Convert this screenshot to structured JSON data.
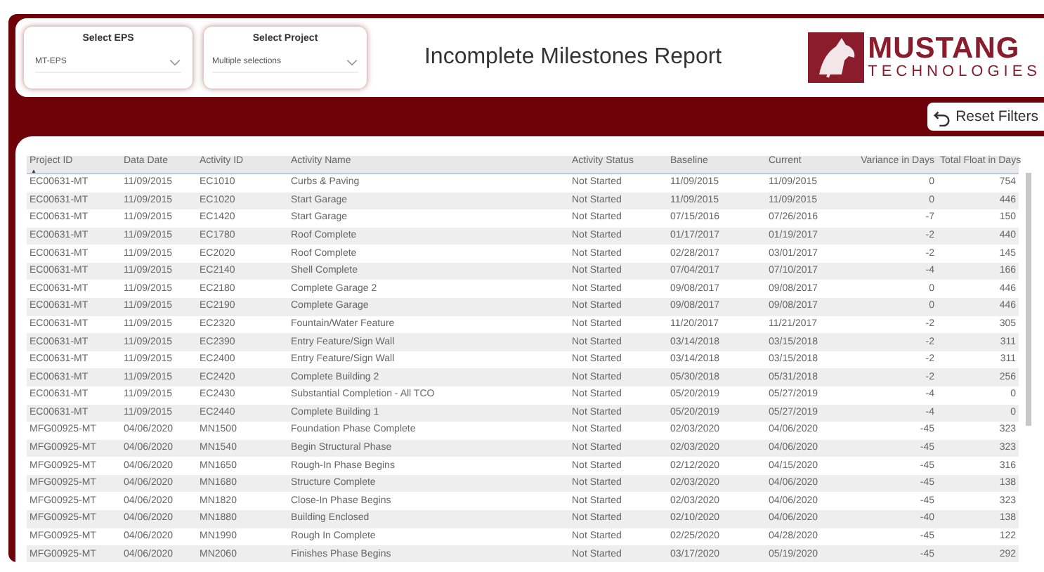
{
  "filters": [
    {
      "label": "Select EPS",
      "value": "MT-EPS"
    },
    {
      "label": "Select Project",
      "value": "Multiple selections"
    }
  ],
  "title": "Incomplete Milestones Report",
  "logo": {
    "name": "MUSTANG",
    "tagline": "TECHNOLOGIES"
  },
  "reset_button": "Reset Filters",
  "table": {
    "columns": [
      {
        "label": "Project ID",
        "kind": "text",
        "sorted": true
      },
      {
        "label": "Data Date",
        "kind": "text",
        "sorted": false
      },
      {
        "label": "Activity ID",
        "kind": "text",
        "sorted": false
      },
      {
        "label": "Activity Name",
        "kind": "text",
        "sorted": false
      },
      {
        "label": "Activity Status",
        "kind": "text",
        "sorted": false
      },
      {
        "label": "Baseline",
        "kind": "text",
        "sorted": false
      },
      {
        "label": "Current",
        "kind": "text",
        "sorted": false
      },
      {
        "label": "Variance in Days",
        "kind": "number",
        "sorted": false
      },
      {
        "label": "Total Float in Days",
        "kind": "number",
        "sorted": false
      }
    ],
    "sort_marker": "▲",
    "rows": [
      [
        "EC00631-MT",
        "11/09/2015",
        "EC1010",
        "Curbs & Paving",
        "Not Started",
        "11/09/2015",
        "11/09/2015",
        "0",
        "754"
      ],
      [
        "EC00631-MT",
        "11/09/2015",
        "EC1020",
        "Start Garage",
        "Not Started",
        "11/09/2015",
        "11/09/2015",
        "0",
        "446"
      ],
      [
        "EC00631-MT",
        "11/09/2015",
        "EC1420",
        "Start Garage",
        "Not Started",
        "07/15/2016",
        "07/26/2016",
        "-7",
        "150"
      ],
      [
        "EC00631-MT",
        "11/09/2015",
        "EC1780",
        "Roof Complete",
        "Not Started",
        "01/17/2017",
        "01/19/2017",
        "-2",
        "440"
      ],
      [
        "EC00631-MT",
        "11/09/2015",
        "EC2020",
        "Roof Complete",
        "Not Started",
        "02/28/2017",
        "03/01/2017",
        "-2",
        "145"
      ],
      [
        "EC00631-MT",
        "11/09/2015",
        "EC2140",
        "Shell Complete",
        "Not Started",
        "07/04/2017",
        "07/10/2017",
        "-4",
        "166"
      ],
      [
        "EC00631-MT",
        "11/09/2015",
        "EC2180",
        "Complete Garage 2",
        "Not Started",
        "09/08/2017",
        "09/08/2017",
        "0",
        "446"
      ],
      [
        "EC00631-MT",
        "11/09/2015",
        "EC2190",
        "Complete Garage",
        "Not Started",
        "09/08/2017",
        "09/08/2017",
        "0",
        "446"
      ],
      [
        "EC00631-MT",
        "11/09/2015",
        "EC2320",
        "Fountain/Water Feature",
        "Not Started",
        "11/20/2017",
        "11/21/2017",
        "-2",
        "305"
      ],
      [
        "EC00631-MT",
        "11/09/2015",
        "EC2390",
        "Entry Feature/Sign Wall",
        "Not Started",
        "03/14/2018",
        "03/15/2018",
        "-2",
        "311"
      ],
      [
        "EC00631-MT",
        "11/09/2015",
        "EC2400",
        "Entry Feature/Sign Wall",
        "Not Started",
        "03/14/2018",
        "03/15/2018",
        "-2",
        "311"
      ],
      [
        "EC00631-MT",
        "11/09/2015",
        "EC2420",
        "Complete Building 2",
        "Not Started",
        "05/30/2018",
        "05/31/2018",
        "-2",
        "256"
      ],
      [
        "EC00631-MT",
        "11/09/2015",
        "EC2430",
        "Substantial Completion - All TCO",
        "Not Started",
        "05/20/2019",
        "05/27/2019",
        "-4",
        "0"
      ],
      [
        "EC00631-MT",
        "11/09/2015",
        "EC2440",
        "Complete Building 1",
        "Not Started",
        "05/20/2019",
        "05/27/2019",
        "-4",
        "0"
      ],
      [
        "MFG00925-MT",
        "04/06/2020",
        "MN1500",
        "Foundation Phase Complete",
        "Not Started",
        "02/03/2020",
        "04/06/2020",
        "-45",
        "323"
      ],
      [
        "MFG00925-MT",
        "04/06/2020",
        "MN1540",
        "Begin Structural Phase",
        "Not Started",
        "02/03/2020",
        "04/06/2020",
        "-45",
        "323"
      ],
      [
        "MFG00925-MT",
        "04/06/2020",
        "MN1650",
        "Rough-In Phase Begins",
        "Not Started",
        "02/12/2020",
        "04/15/2020",
        "-45",
        "316"
      ],
      [
        "MFG00925-MT",
        "04/06/2020",
        "MN1680",
        "Structure Complete",
        "Not Started",
        "02/03/2020",
        "04/06/2020",
        "-45",
        "138"
      ],
      [
        "MFG00925-MT",
        "04/06/2020",
        "MN1820",
        "Close-In Phase Begins",
        "Not Started",
        "02/03/2020",
        "04/06/2020",
        "-45",
        "323"
      ],
      [
        "MFG00925-MT",
        "04/06/2020",
        "MN1880",
        "Building Enclosed",
        "Not Started",
        "02/10/2020",
        "04/06/2020",
        "-40",
        "138"
      ],
      [
        "MFG00925-MT",
        "04/06/2020",
        "MN1990",
        "Rough In Complete",
        "Not Started",
        "02/25/2020",
        "04/28/2020",
        "-45",
        "122"
      ],
      [
        "MFG00925-MT",
        "04/06/2020",
        "MN2060",
        "Finishes Phase Begins",
        "Not Started",
        "03/17/2020",
        "05/19/2020",
        "-45",
        "292"
      ]
    ]
  }
}
